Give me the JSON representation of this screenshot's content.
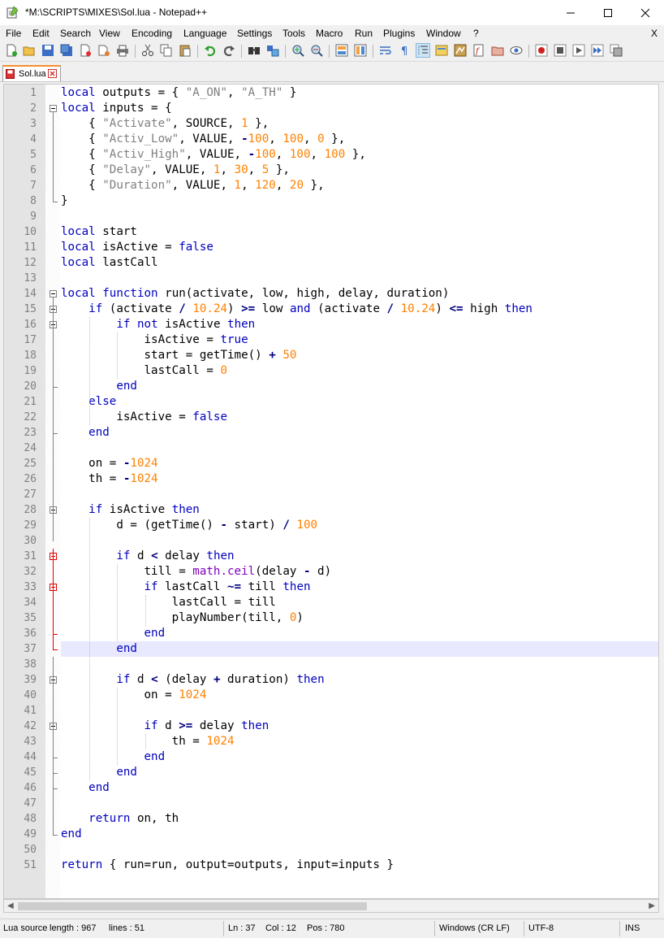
{
  "window": {
    "title": "*M:\\SCRIPTS\\MIXES\\Sol.lua - Notepad++",
    "minimize": "—",
    "maximize": "☐",
    "close": "✕"
  },
  "menu": [
    "File",
    "Edit",
    "Search",
    "View",
    "Encoding",
    "Language",
    "Settings",
    "Tools",
    "Macro",
    "Run",
    "Plugins",
    "Window",
    "?"
  ],
  "menu_close": "X",
  "tab": {
    "label": "Sol.lua"
  },
  "code": [
    "local outputs = { \"A_ON\", \"A_TH\" }",
    "local inputs = {",
    "    { \"Activate\", SOURCE, 1 },",
    "    { \"Activ_Low\", VALUE, -100, 100, 0 },",
    "    { \"Activ_High\", VALUE, -100, 100, 100 },",
    "    { \"Delay\", VALUE, 1, 30, 5 },",
    "    { \"Duration\", VALUE, 1, 120, 20 },",
    "}",
    "",
    "local start",
    "local isActive = false",
    "local lastCall",
    "",
    "local function run(activate, low, high, delay, duration)",
    "    if (activate / 10.24) >= low and (activate / 10.24) <= high then",
    "        if not isActive then",
    "            isActive = true",
    "            start = getTime() + 50",
    "            lastCall = 0",
    "        end",
    "    else",
    "        isActive = false",
    "    end",
    "",
    "    on = -1024",
    "    th = -1024",
    "",
    "    if isActive then",
    "        d = (getTime() - start) / 100",
    "",
    "        if d < delay then",
    "            till = math.ceil(delay - d)",
    "            if lastCall ~= till then",
    "                lastCall = till",
    "                playNumber(till, 0)",
    "            end",
    "        end",
    "",
    "        if d < (delay + duration) then",
    "            on = 1024",
    "",
    "            if d >= delay then",
    "                th = 1024",
    "            end",
    "        end",
    "    end",
    "",
    "    return on, th",
    "end",
    "",
    "return { run=run, output=outputs, input=inputs }"
  ],
  "current_line": 37,
  "status": {
    "type": "Lua source file",
    "length": "length : 967",
    "lines": "lines : 51",
    "ln": "Ln : 37",
    "col": "Col : 12",
    "pos": "Pos : 780",
    "eol": "Windows (CR LF)",
    "encoding": "UTF-8",
    "mode": "INS"
  },
  "colors": {
    "keyword": "#0000c0",
    "string": "#808080",
    "number": "#ff8000",
    "function": "#8000c0",
    "current_line_bg": "#e8e8ff"
  }
}
